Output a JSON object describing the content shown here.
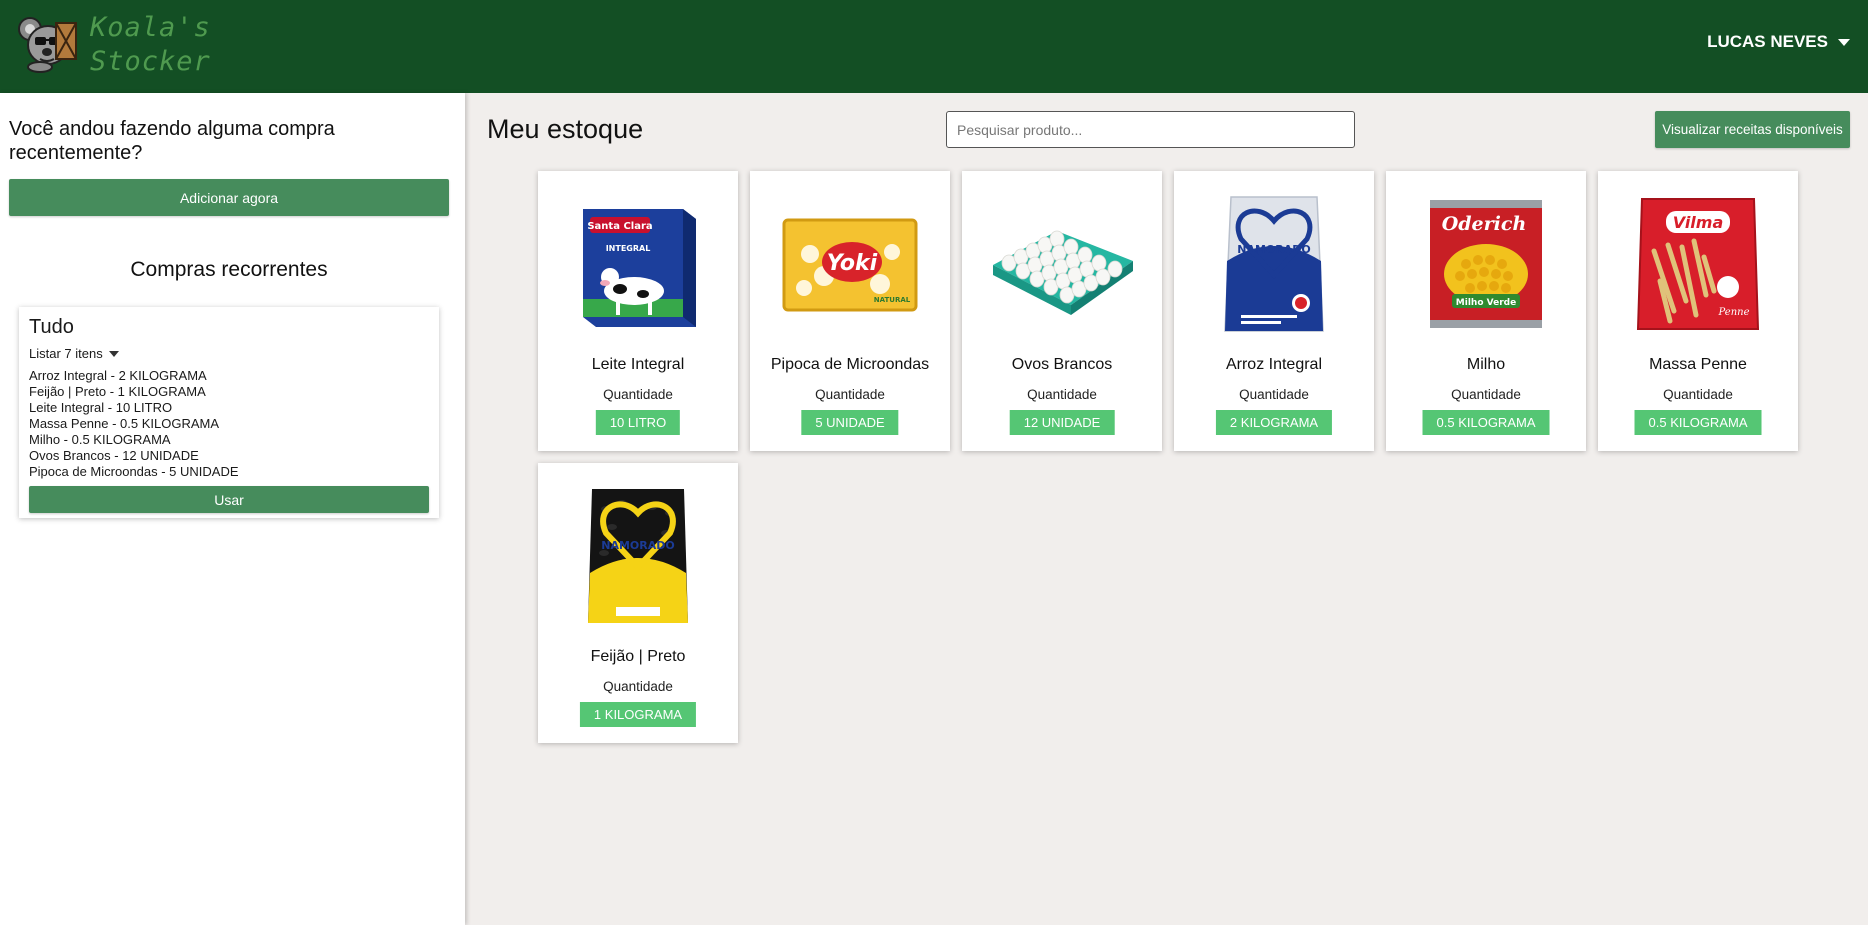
{
  "header": {
    "logo_line1": "Koala's",
    "logo_line2": "Stocker",
    "user_name": "LUCAS NEVES"
  },
  "sidebar": {
    "prompt": "Você andou fazendo alguma compra recentemente?",
    "add_now_label": "Adicionar agora",
    "recurring_title": "Compras recorrentes",
    "recurring_card": {
      "title": "Tudo",
      "toggle_label": "Listar 7 itens",
      "items": [
        "Arroz Integral - 2 KILOGRAMA",
        "Feijão | Preto - 1 KILOGRAMA",
        "Leite Integral - 10 LITRO",
        "Massa Penne - 0.5 KILOGRAMA",
        "Milho - 0.5 KILOGRAMA",
        "Ovos Brancos - 12 UNIDADE",
        "Pipoca de Microondas - 5 UNIDADE"
      ],
      "use_label": "Usar"
    }
  },
  "main": {
    "title": "Meu estoque",
    "search_placeholder": "Pesquisar produto...",
    "recipes_button": "Visualizar receitas disponíveis",
    "quantity_label": "Quantidade",
    "products": [
      {
        "name": "Leite Integral",
        "quantity": "10 LITRO",
        "icon": "milk-carton-icon",
        "package_text": "Santa Clara",
        "package_subtext": "INTEGRAL"
      },
      {
        "name": "Pipoca de Microondas",
        "quantity": "5 UNIDADE",
        "icon": "popcorn-bag-icon",
        "package_text": "Yoki",
        "package_subtext": "NATURAL"
      },
      {
        "name": "Ovos Brancos",
        "quantity": "12 UNIDADE",
        "icon": "egg-tray-icon"
      },
      {
        "name": "Arroz Integral",
        "quantity": "2 KILOGRAMA",
        "icon": "rice-bag-icon",
        "package_text": "NAMORADO"
      },
      {
        "name": "Milho",
        "quantity": "0.5 KILOGRAMA",
        "icon": "corn-can-icon",
        "package_text": "Oderich",
        "package_subtext": "Milho Verde"
      },
      {
        "name": "Massa Penne",
        "quantity": "0.5 KILOGRAMA",
        "icon": "pasta-bag-icon",
        "package_text": "Vilma",
        "package_subtext": "Penne"
      },
      {
        "name": "Feijão | Preto",
        "quantity": "1 KILOGRAMA",
        "icon": "bean-bag-icon",
        "package_text": "NAMORADO"
      }
    ]
  },
  "colors": {
    "header_bg": "#134f24",
    "logo_text": "#4f9a4f",
    "button_green": "#468c5c",
    "badge_green": "#55c674",
    "page_bg": "#f1eeec"
  }
}
